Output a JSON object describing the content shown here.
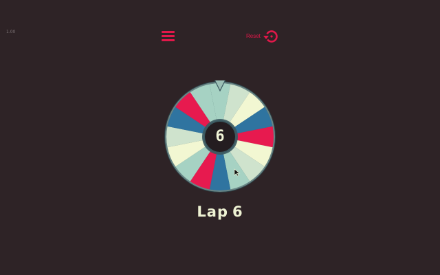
{
  "version_label": "1.00",
  "header": {
    "menu_icon": "hamburger-menu-icon",
    "reset_label": "Reset",
    "reset_icon": "reset-rotate-icon"
  },
  "wheel": {
    "current_number": "6",
    "pointer_icon": "triangle-pointer-icon",
    "segment_colors": [
      "#2f74a0",
      "#e71a4f",
      "#f2f7d2",
      "#a6d2c3",
      "#cfe3cd"
    ]
  },
  "lap": {
    "label": "Lap",
    "number": "6"
  },
  "colors": {
    "background": "#2e2326",
    "accent": "#e2184a",
    "text": "#f2f6d8"
  }
}
